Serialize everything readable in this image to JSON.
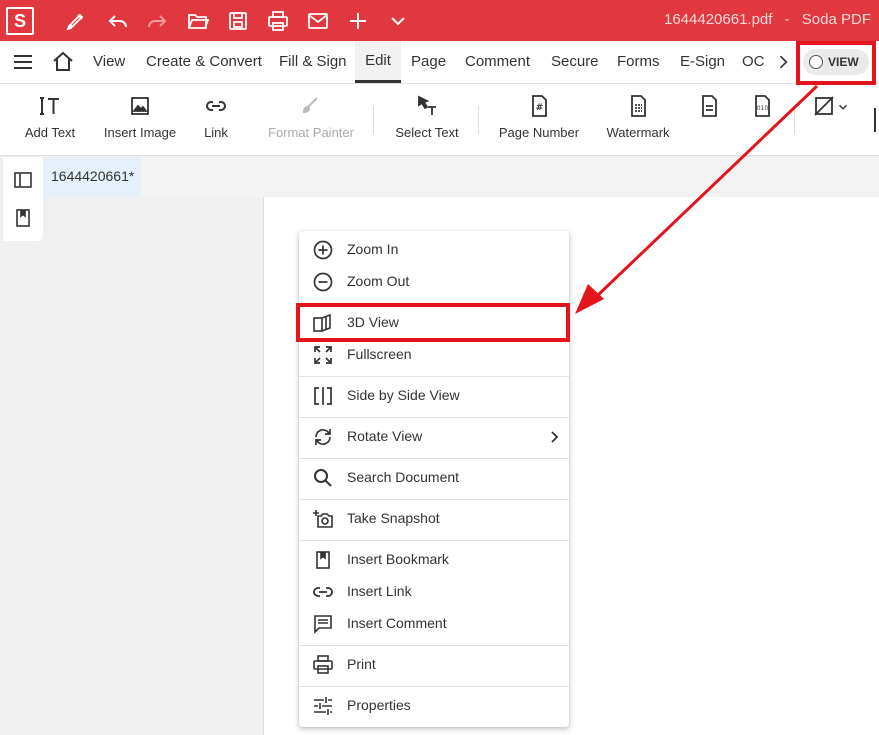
{
  "titlebar": {
    "logo": "S",
    "document_title": "1644420661.pdf",
    "separator": "-",
    "app_name": "Soda PDF",
    "color": "#e0383e"
  },
  "menubar": {
    "items": [
      "View",
      "Create & Convert",
      "Fill & Sign",
      "Edit",
      "Page",
      "Comment",
      "Secure",
      "Forms",
      "E-Sign",
      "OC"
    ],
    "active": "Edit",
    "view_toggle": "VIEW"
  },
  "ribbon": {
    "add_text": "Add Text",
    "insert_image": "Insert Image",
    "link": "Link",
    "format_painter": "Format Painter",
    "select_text": "Select Text",
    "page_number": "Page Number",
    "watermark": "Watermark"
  },
  "doc_tab": "1644420661*",
  "context_menu": {
    "items": [
      {
        "label": "Zoom In",
        "icon": "zoom-in-icon"
      },
      {
        "label": "Zoom Out",
        "icon": "zoom-out-icon"
      },
      {
        "label": "3D View",
        "icon": "3d-view-icon"
      },
      {
        "label": "Fullscreen",
        "icon": "fullscreen-icon"
      },
      {
        "label": "Side by Side View",
        "icon": "side-by-side-icon"
      },
      {
        "label": "Rotate View",
        "icon": "rotate-icon"
      },
      {
        "label": "Search Document",
        "icon": "search-icon"
      },
      {
        "label": "Take Snapshot",
        "icon": "camera-icon"
      },
      {
        "label": "Insert Bookmark",
        "icon": "bookmark-icon"
      },
      {
        "label": "Insert Link",
        "icon": "link-icon"
      },
      {
        "label": "Insert Comment",
        "icon": "comment-icon"
      },
      {
        "label": "Print",
        "icon": "print-icon"
      },
      {
        "label": "Properties",
        "icon": "properties-icon"
      }
    ]
  },
  "annotation_color": "#e3141b"
}
